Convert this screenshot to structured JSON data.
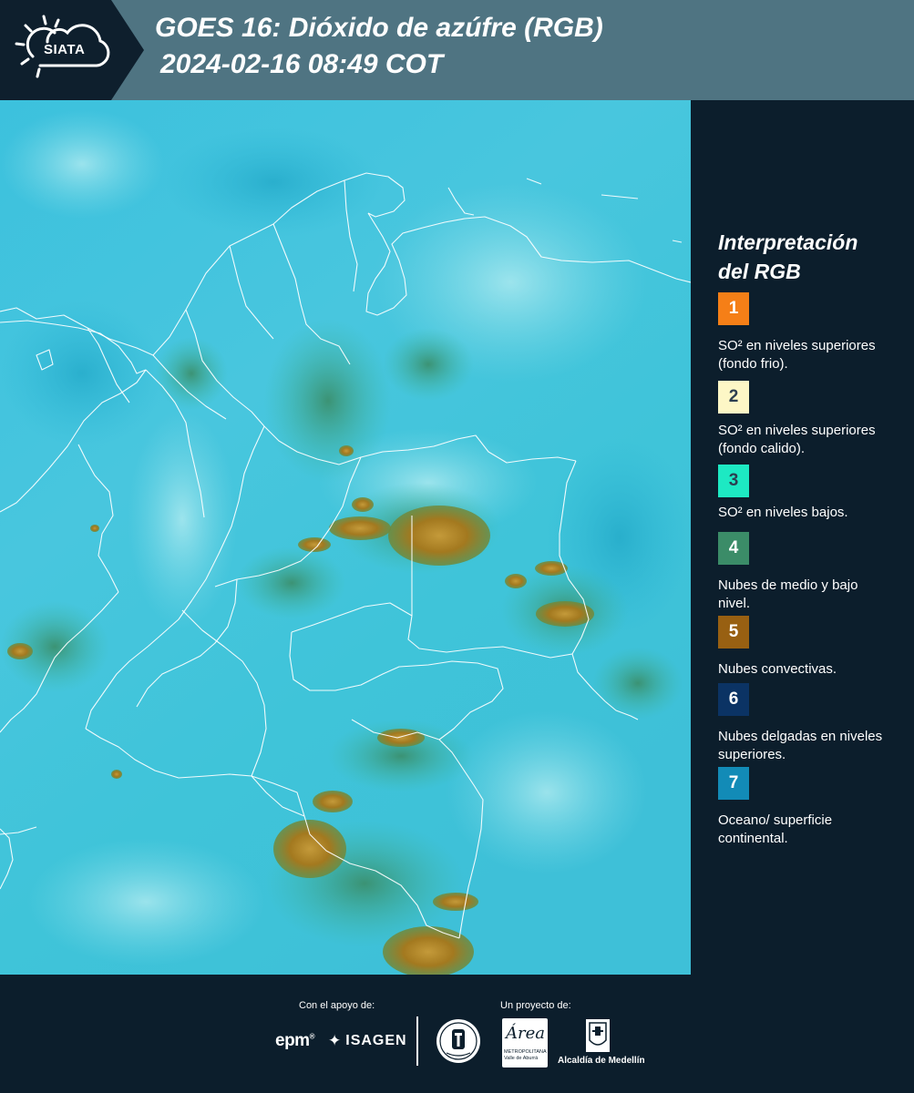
{
  "header": {
    "logo_text": "SIATA",
    "title_line1": "GOES 16: Dióxido de azúfre (RGB)",
    "title_line2": " 2024-02-16 08:49 COT"
  },
  "legend": {
    "title_line1": "Interpretación",
    "title_line2": "del RGB",
    "items": [
      {
        "number": "1",
        "color": "#f57f17",
        "text_color": "#ffffff",
        "description": "SO² en niveles superiores (fondo frio)."
      },
      {
        "number": "2",
        "color": "#fdf7c6",
        "text_color": "#2c3e50",
        "description": "SO² en niveles superiores (fondo calido)."
      },
      {
        "number": "3",
        "color": "#1de9c3",
        "text_color": "#2c3e50",
        "description": "SO² en niveles bajos."
      },
      {
        "number": "4",
        "color": "#3b8c68",
        "text_color": "#ffffff",
        "description": "Nubes de medio y bajo nivel."
      },
      {
        "number": "5",
        "color": "#986012",
        "text_color": "#ffffff",
        "description": "Nubes convectivas."
      },
      {
        "number": "6",
        "color": "#0b3364",
        "text_color": "#ffffff",
        "description": "Nubes delgadas en niveles superiores."
      },
      {
        "number": "7",
        "color": "#128bb7",
        "text_color": "#ffffff",
        "description": "Oceano/ superficie continental."
      }
    ]
  },
  "footer": {
    "support_label": "Con el apoyo de:",
    "project_label": "Un proyecto de:",
    "epm": "epm",
    "epm_reg": "®",
    "isagen": "ISAGEN",
    "area_word": "Área",
    "area_sub": "METROPOLITANA Valle de Aburrá",
    "alcaldia": "Alcaldía de Medellín"
  },
  "colors": {
    "header_bg": "#4f7482",
    "panel_bg": "#0c1e2c",
    "map_base": "#3fc3dc",
    "cloud_convective": "#a3791f",
    "cloud_midlevel": "#3d8f63",
    "border_lines": "#ffffff"
  }
}
